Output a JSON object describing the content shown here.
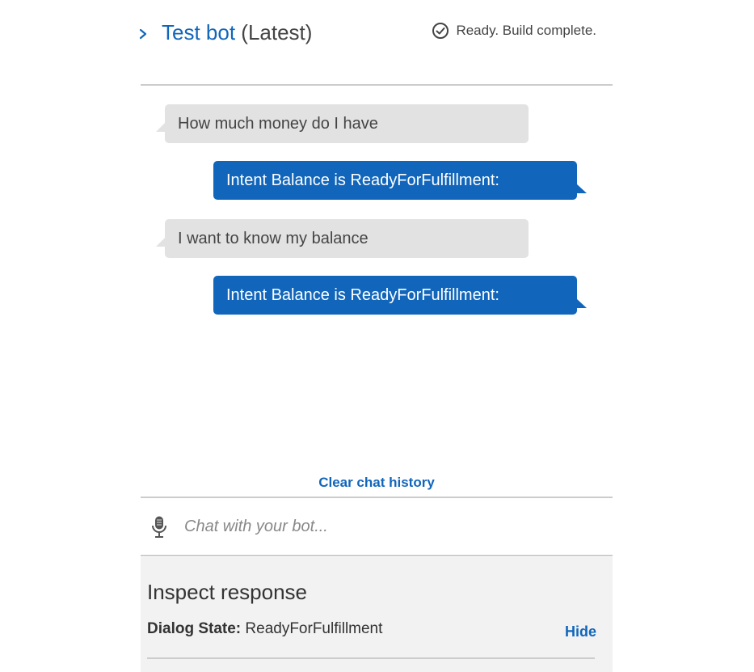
{
  "header": {
    "title": "Test bot",
    "version": "(Latest)",
    "status": "Ready. Build complete."
  },
  "messages": [
    {
      "from": "user",
      "text": "How much money do I have"
    },
    {
      "from": "bot",
      "text": "Intent Balance is ReadyForFulfillment:"
    },
    {
      "from": "user",
      "text": "I want to know my balance"
    },
    {
      "from": "bot",
      "text": "Intent Balance is ReadyForFulfillment:"
    }
  ],
  "clear_label": "Clear chat history",
  "chat_input": {
    "placeholder": "Chat with your bot...",
    "value": ""
  },
  "inspect": {
    "title": "Inspect response",
    "dialog_state_label": "Dialog State:",
    "dialog_state_value": "ReadyForFulfillment",
    "hide_label": "Hide"
  },
  "colors": {
    "accent": "#1166bb",
    "user_bubble": "#e2e2e2",
    "panel": "#f2f2f2"
  },
  "icons": {
    "expand": "chevron-right-icon",
    "status": "check-circle-icon",
    "mic": "microphone-icon"
  }
}
